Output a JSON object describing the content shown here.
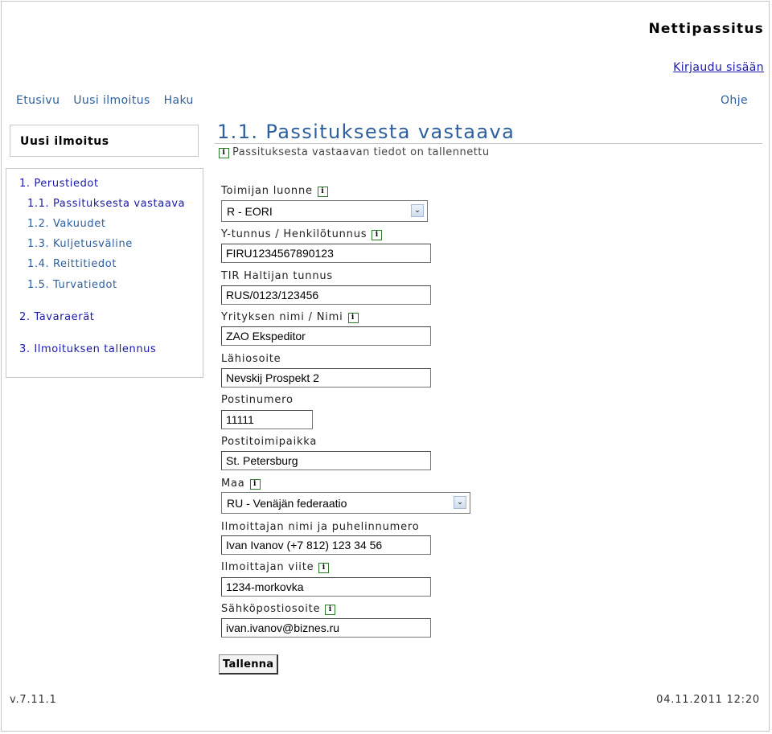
{
  "header": {
    "app_title": "Nettipassitus",
    "login_link": "Kirjaudu sisään"
  },
  "nav": {
    "items": [
      "Etusivu",
      "Uusi ilmoitus",
      "Haku"
    ],
    "help": "Ohje"
  },
  "sidebar": {
    "title": "Uusi ilmoitus",
    "items": [
      {
        "label": "1. Perustiedot"
      },
      {
        "label": "1.1. Passituksesta vastaava"
      },
      {
        "label": "1.2. Vakuudet"
      },
      {
        "label": "1.3. Kuljetusväline"
      },
      {
        "label": "1.4. Reittitiedot"
      },
      {
        "label": "1.5. Turvatiedot"
      },
      {
        "label": "2. Tavaraerät"
      },
      {
        "label": "3. Ilmoituksen tallennus"
      }
    ]
  },
  "main": {
    "title": "1.1. Passituksesta vastaava",
    "info_message": "Passituksesta vastaavan tiedot on tallennettu",
    "info_icon": "info-icon",
    "form": {
      "operator_type": {
        "label": "Toimijan luonne",
        "value": "R - EORI"
      },
      "business_id": {
        "label": "Y-tunnus / Henkilötunnus",
        "value": "FIRU1234567890123"
      },
      "tir_holder": {
        "label": "TIR Haltijan tunnus",
        "value": "RUS/0123/123456"
      },
      "company_name": {
        "label": "Yrityksen nimi / Nimi",
        "value": "ZAO Ekspeditor"
      },
      "street": {
        "label": "Lähiosoite",
        "value": "Nevskij Prospekt 2"
      },
      "postal_code": {
        "label": "Postinumero",
        "value": "11111"
      },
      "city": {
        "label": "Postitoimipaikka",
        "value": "St. Petersburg"
      },
      "country": {
        "label": "Maa",
        "value": "RU - Venäjän federaatio"
      },
      "declarant": {
        "label": "Ilmoittajan nimi ja puhelinnumero",
        "value": "Ivan Ivanov (+7 812) 123 34 56"
      },
      "reference": {
        "label": "Ilmoittajan viite",
        "value": "1234-morkovka"
      },
      "email": {
        "label": "Sähköpostiosoite",
        "value": "ivan.ivanov@biznes.ru"
      }
    },
    "save_button": "Tallenna"
  },
  "footer": {
    "version": "v.7.11.1",
    "datetime": "04.11.2011 12:20"
  }
}
